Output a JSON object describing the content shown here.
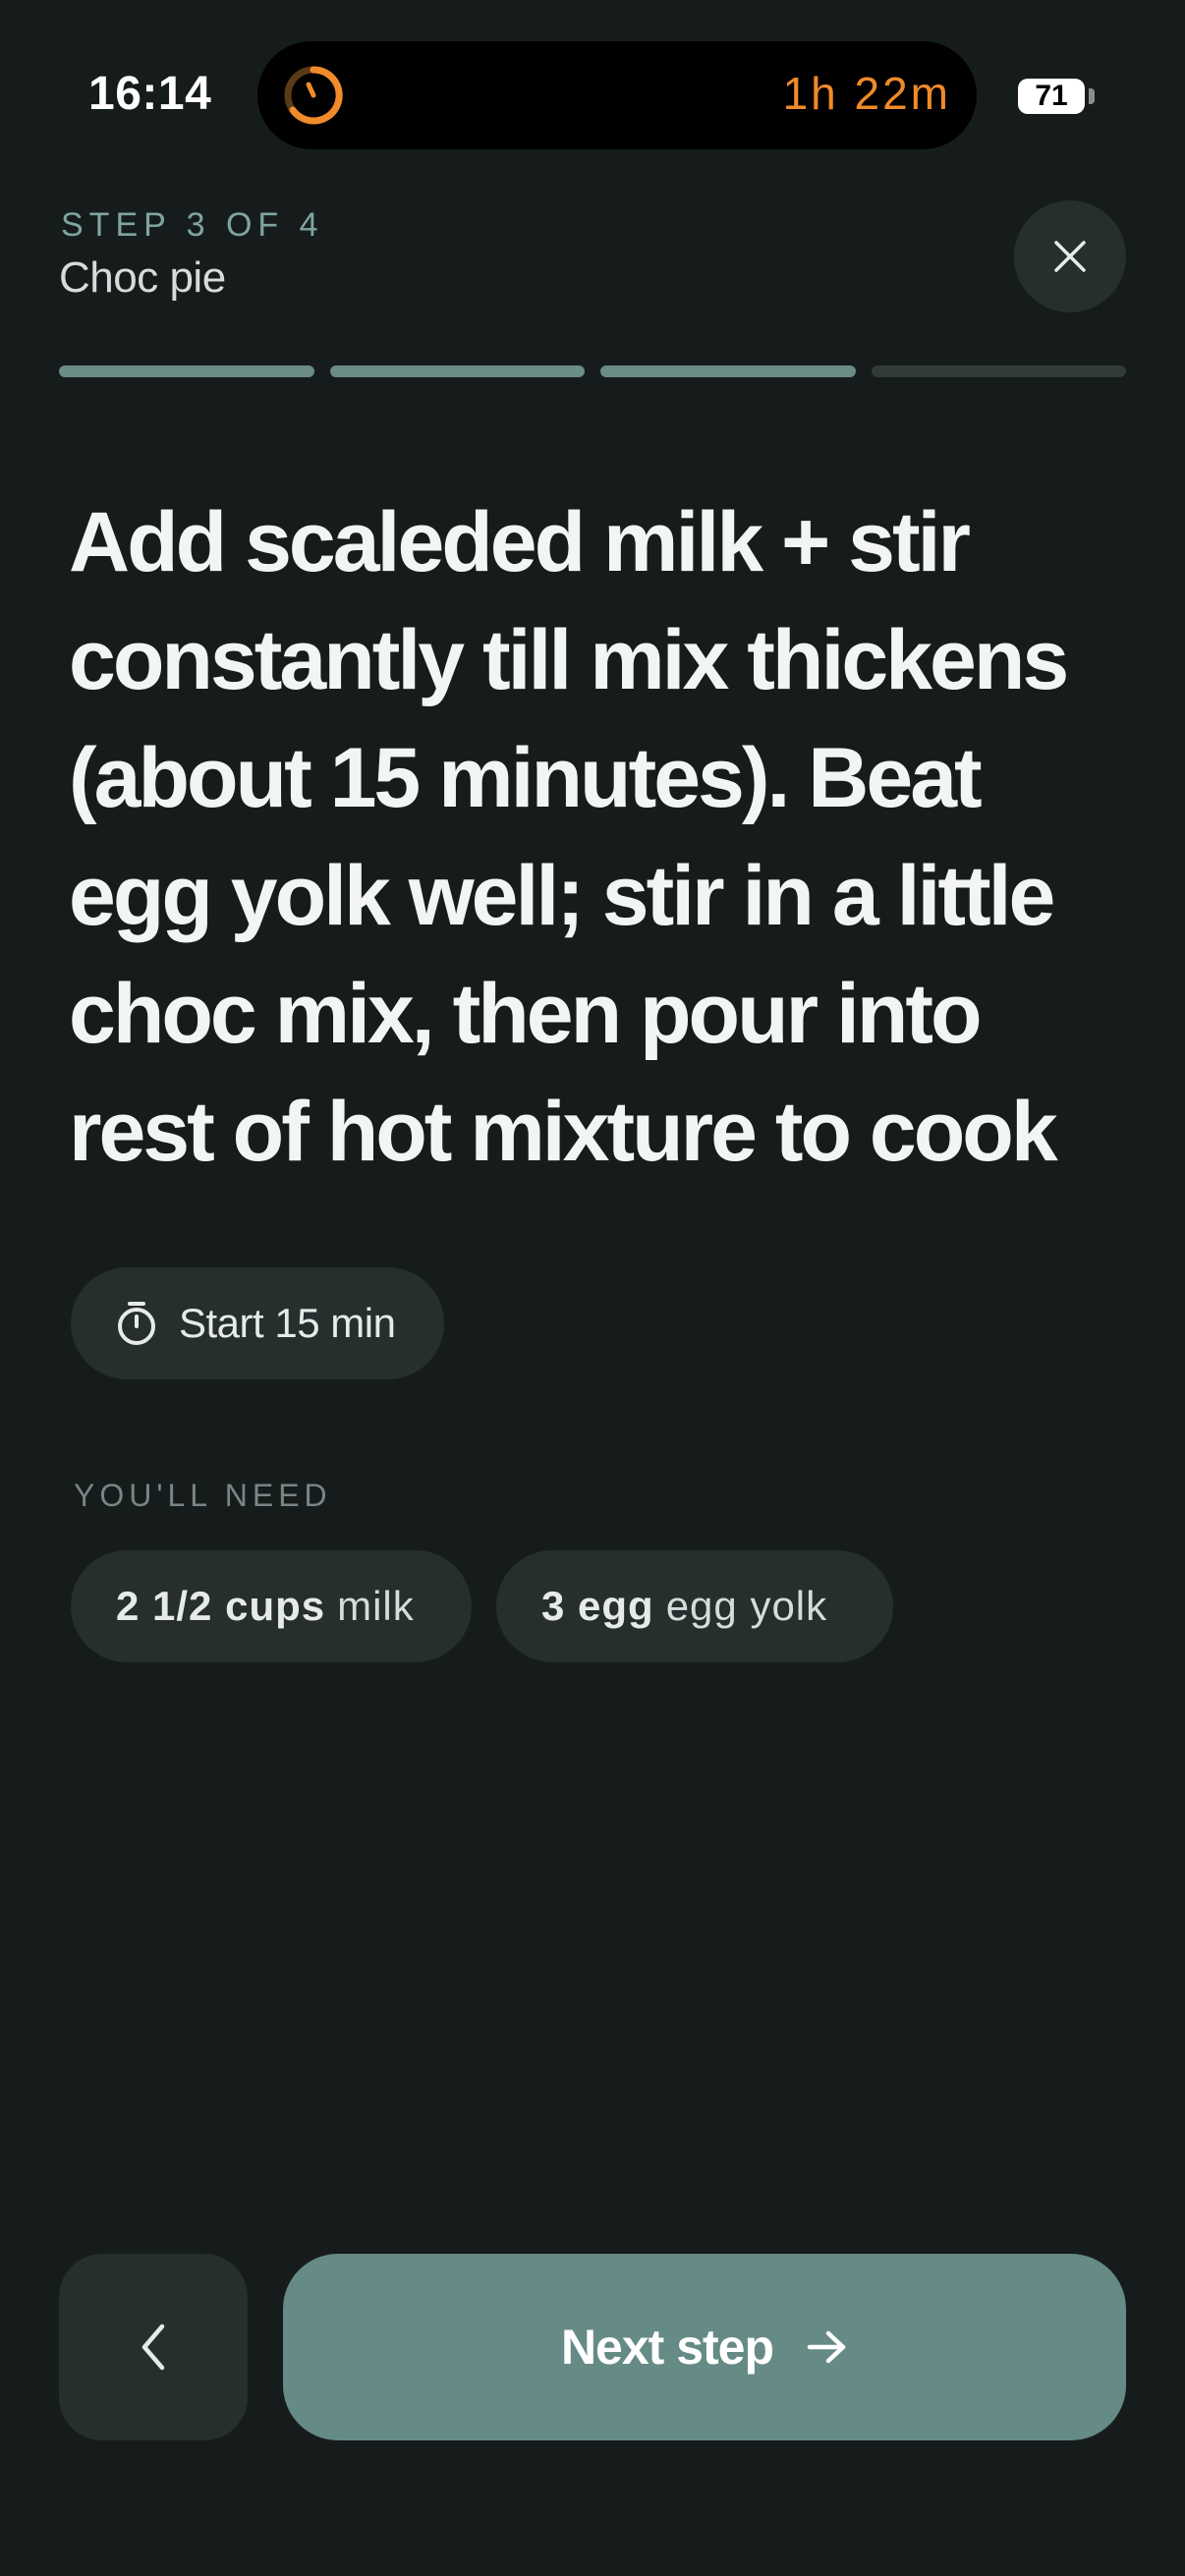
{
  "status_bar": {
    "time": "16:14",
    "live_activity_text": "1h 22m",
    "battery": "71"
  },
  "header": {
    "step_label": "STEP 3 OF 4",
    "recipe_name": "Choc pie"
  },
  "progress": {
    "total_steps": 4,
    "completed_steps": 3
  },
  "instruction": "Add scaleded milk + stir constantly till mix thickens (about 15 minutes). Beat egg yolk well; stir in a little choc mix, then pour into rest of hot mixture to cook",
  "timer": {
    "label": "Start 15 min"
  },
  "ingredients": {
    "title": "YOU'LL NEED",
    "items": [
      {
        "quantity": "2 1/2 cups",
        "name": "milk"
      },
      {
        "quantity": "3 egg",
        "name": "egg yolk"
      }
    ]
  },
  "navigation": {
    "next_label": "Next step"
  },
  "colors": {
    "background": "#161c1c",
    "accent": "#668a85",
    "chip": "#262e2e",
    "live_activity": "#f08a2a"
  }
}
